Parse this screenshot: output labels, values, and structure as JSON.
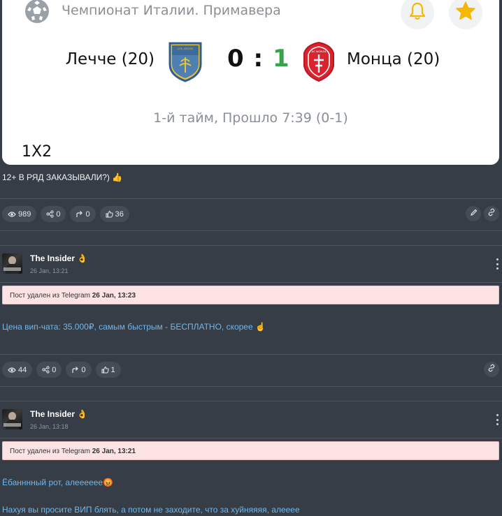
{
  "match_card": {
    "league": "Чемпионат Италии. Примавера",
    "home_team": "Лечче (20)",
    "away_team": "Монца (20)",
    "home_score": "0",
    "separator": ":",
    "away_score": "1",
    "status": "1-й тайм, Прошло 7:39 (0-1)",
    "market": "1X2",
    "icons": {
      "league": "soccer-ball-icon",
      "bell": "bell-icon",
      "star": "star-icon"
    },
    "colors": {
      "away_score": "#37a34a",
      "star": "#f5b800",
      "bell": "#f5b800",
      "lecce": "#3d6b9c",
      "monza": "#d9232e"
    },
    "crest_text": {
      "home": "U.S. LECCE",
      "away": "AC MONZA"
    }
  },
  "posts": [
    {
      "text": "12+ В РЯД ЗАКАЗЫВАЛИ?) 👍",
      "stats": {
        "views": "989",
        "shares": "0",
        "forwards": "0",
        "likes": "36"
      }
    },
    {
      "author": "The Insider 👌",
      "time": "26 Jan, 13:21",
      "deleted_prefix": "Пост удален из Telegram",
      "deleted_time": "26 Jan, 13:23",
      "text": "Цена вип-чата: 35.000₽, самым быстрым - БЕСПЛАТНО, скорее ☝",
      "stats": {
        "views": "44",
        "shares": "0",
        "forwards": "0",
        "likes": "1"
      }
    },
    {
      "author": "The Insider 👌",
      "time": "26 Jan, 13:18",
      "deleted_prefix": "Пост удален из Telegram",
      "deleted_time": "26 Jan, 13:21",
      "text_line_1": "Ёбанннный рот, алееееее😡",
      "text_line_2": "Нахуя вы просите ВИП блять, а потом не заходите, что за хуйняяяя, алееее"
    }
  ]
}
